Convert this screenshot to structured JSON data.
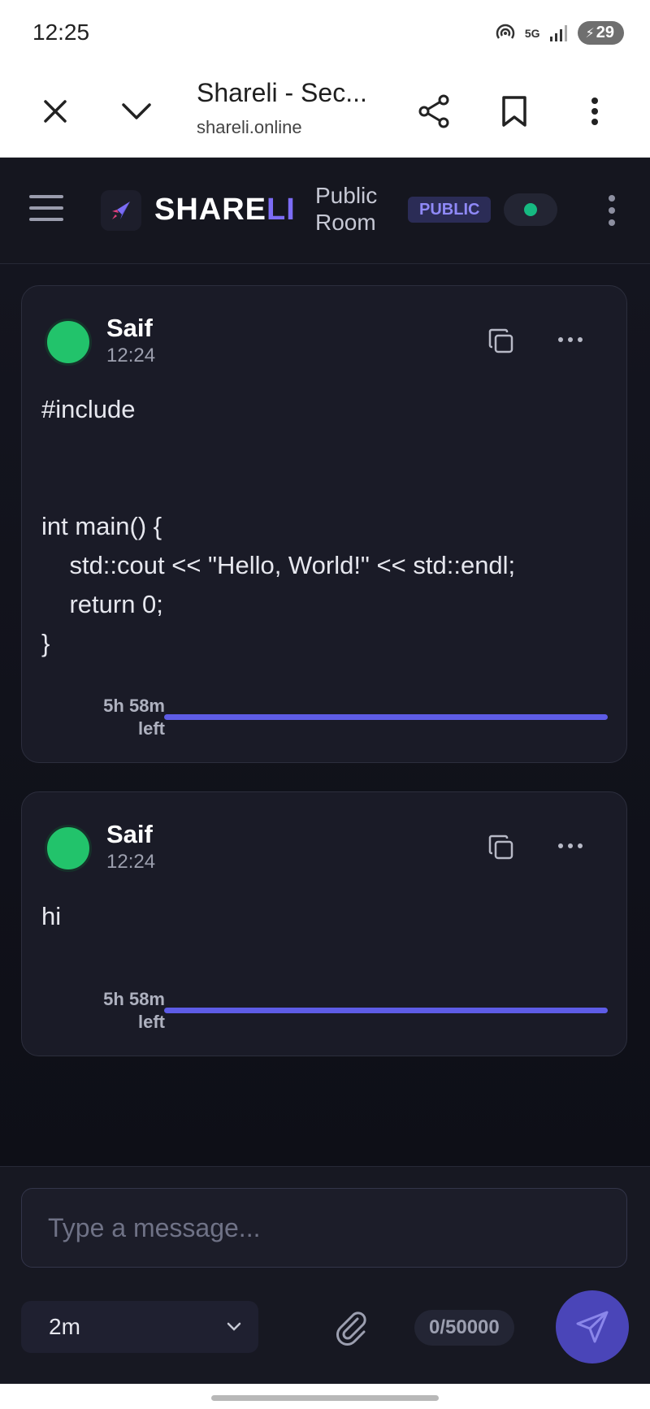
{
  "status_bar": {
    "time": "12:25",
    "network": "5G",
    "battery": "29"
  },
  "browser": {
    "title": "Shareli - Sec...",
    "url": "shareli.online"
  },
  "header": {
    "brand_main": "SHARE",
    "brand_accent": "LI",
    "room_name": "Public Room",
    "badge": "PUBLIC",
    "connection_color": "#16b981"
  },
  "messages": [
    {
      "author": "Saif",
      "time": "12:24",
      "content": "#include\n\n\nint main() {\n    std::cout << \"Hello, World!\" << std::endl;\n    return 0;\n}",
      "ttl_label": "5h 58m\nleft",
      "ttl_progress": 1.0
    },
    {
      "author": "Saif",
      "time": "12:24",
      "content": "hi",
      "ttl_label": "5h 58m\nleft",
      "ttl_progress": 1.0
    }
  ],
  "composer": {
    "placeholder": "Type a message...",
    "ttl_value": "2m",
    "char_count": "0/50000"
  },
  "colors": {
    "accent": "#5e5ce6",
    "avatar": "#22c36b",
    "background": "#0f1018"
  }
}
